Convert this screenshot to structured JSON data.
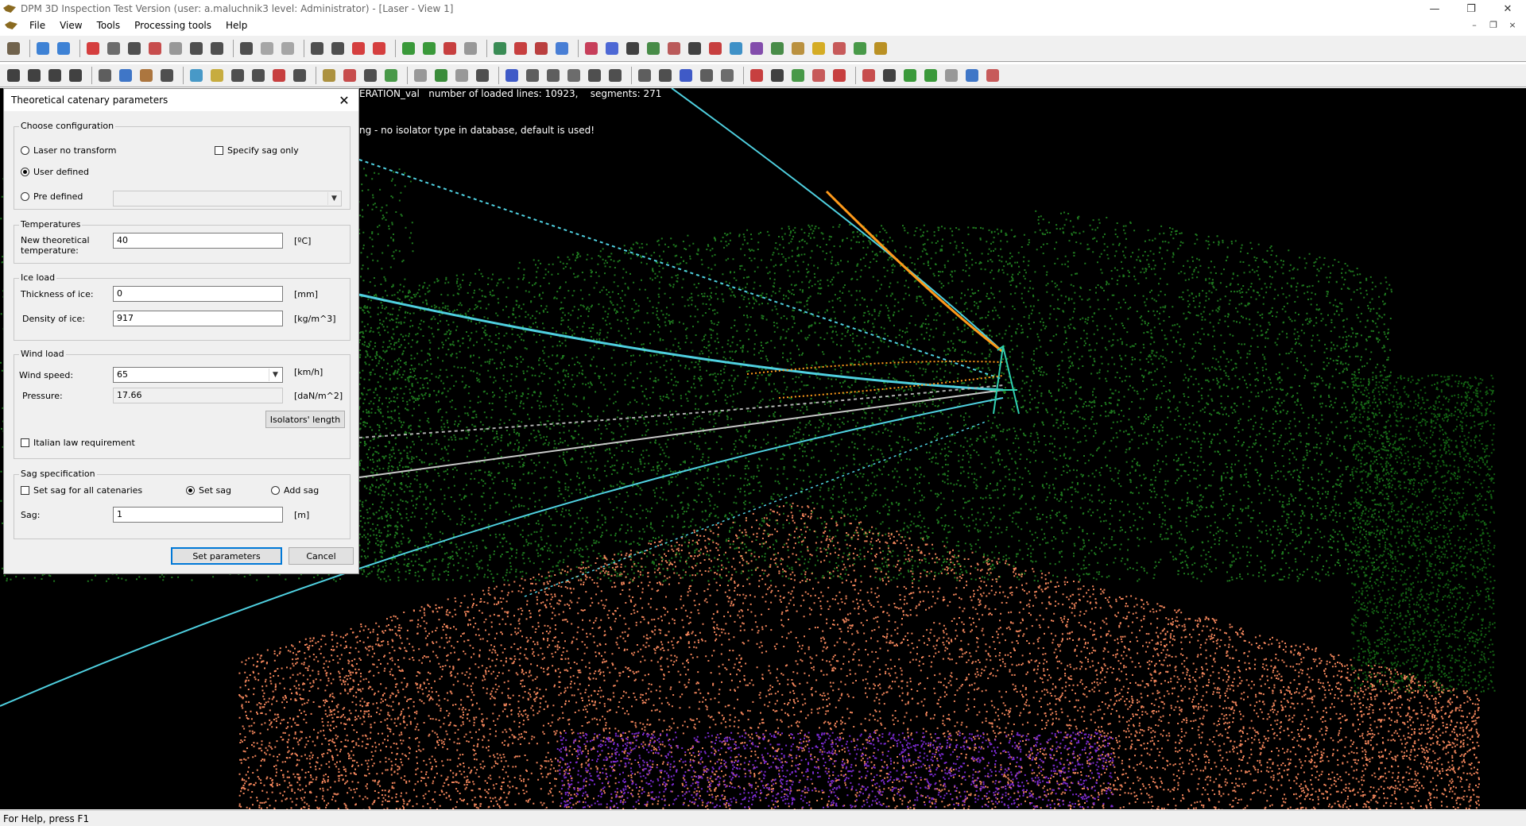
{
  "window": {
    "title": "DPM 3D Inspection Test Version (user: a.maluchnik3 level: Administrator) - [Laser - View 1]",
    "minimize": "—",
    "restore": "❐",
    "close": "✕"
  },
  "menu": {
    "items": [
      "File",
      "View",
      "Tools",
      "Processing tools",
      "Help"
    ],
    "mdi_min": "–",
    "mdi_restore": "❐",
    "mdi_close": "×"
  },
  "viewport": {
    "info_line": "ERATION_val   number of loaded lines: 10923,    segments: 271",
    "warning_line": "ng - no isolator type in database, default is used!"
  },
  "dialog": {
    "title": "Theoretical catenary parameters",
    "close": "✕",
    "config": {
      "legend": "Choose configuration",
      "laser_no_transform": "Laser no transform",
      "specify_sag_only": "Specify sag only",
      "user_defined": "User defined",
      "pre_defined": "Pre defined",
      "pre_defined_value": ""
    },
    "temperatures": {
      "legend": "Temperatures",
      "label": "New theoretical temperature:",
      "value": "40",
      "unit": "[ºC]"
    },
    "ice": {
      "legend": "Ice load",
      "thickness_label": "Thickness of ice:",
      "thickness_value": "0",
      "thickness_unit": "[mm]",
      "density_label": "Density of ice:",
      "density_value": "917",
      "density_unit": "[kg/m^3]"
    },
    "wind": {
      "legend": "Wind load",
      "speed_label": "Wind speed:",
      "speed_value": "65",
      "speed_unit": "[km/h]",
      "pressure_label": "Pressure:",
      "pressure_value": "17.66",
      "pressure_unit": "[daN/m^2]",
      "isolators_button": "Isolators' length",
      "italian_law": "Italian law requirement"
    },
    "sag": {
      "legend": "Sag specification",
      "set_all": "Set sag for all catenaries",
      "set_sag": "Set sag",
      "add_sag": "Add sag",
      "sag_label": "Sag:",
      "sag_value": "1",
      "sag_unit": "[m]"
    },
    "set_parameters": "Set parameters",
    "cancel": "Cancel"
  },
  "status": {
    "text": "For Help, press F1"
  },
  "colors": {
    "vegetation": "#1f7a1f",
    "ground": "#f0845a",
    "water": "#7a2ad0",
    "conductor_cyan": "#4fd0e0",
    "conductor_orange": "#ff9a1a",
    "viewport_bg": "#000000"
  }
}
